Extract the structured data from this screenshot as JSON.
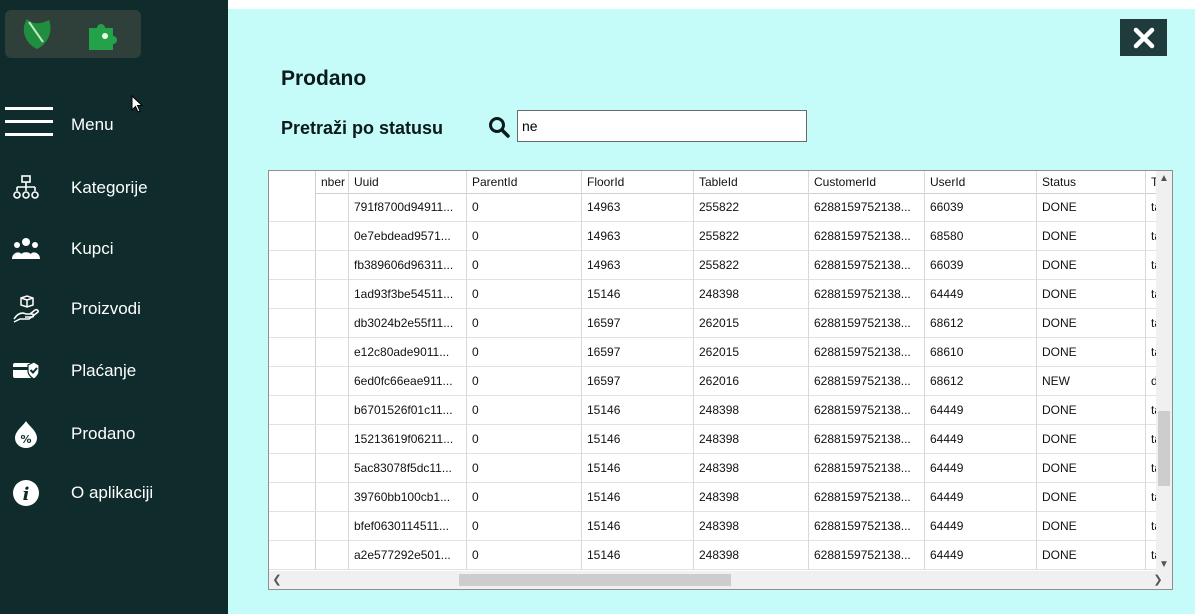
{
  "sidebar": {
    "menu_label": "Menu",
    "items": [
      {
        "label": "Kategorije",
        "icon": "hierarchy-icon"
      },
      {
        "label": "Kupci",
        "icon": "users-icon"
      },
      {
        "label": "Proizvodi",
        "icon": "product-hand-icon"
      },
      {
        "label": "Plaćanje",
        "icon": "payment-check-icon"
      },
      {
        "label": "Prodano",
        "icon": "sold-percent-icon"
      },
      {
        "label": "O aplikaciji",
        "icon": "info-icon"
      }
    ]
  },
  "main": {
    "title": "Prodano",
    "search_label": "Pretraži po statusu",
    "search_value": "ne"
  },
  "grid": {
    "columns": [
      "nber",
      "Uuid",
      "ParentId",
      "FloorId",
      "TableId",
      "CustomerId",
      "UserId",
      "Status",
      "Ty"
    ],
    "rows": [
      [
        "",
        "791f8700d94911...",
        "0",
        "14963",
        "255822",
        "6288159752138...",
        "66039",
        "DONE",
        "tak"
      ],
      [
        "",
        "0e7ebdead9571...",
        "0",
        "14963",
        "255822",
        "6288159752138...",
        "68580",
        "DONE",
        "tak"
      ],
      [
        "",
        "fb389606d96311...",
        "0",
        "14963",
        "255822",
        "6288159752138...",
        "66039",
        "DONE",
        "tak"
      ],
      [
        "",
        "1ad93f3be54511...",
        "0",
        "15146",
        "248398",
        "6288159752138...",
        "64449",
        "DONE",
        "tak"
      ],
      [
        "",
        "db3024b2e55f11...",
        "0",
        "16597",
        "262015",
        "6288159752138...",
        "68612",
        "DONE",
        "tak"
      ],
      [
        "",
        "e12c80ade9011...",
        "0",
        "16597",
        "262015",
        "6288159752138...",
        "68610",
        "DONE",
        "tak"
      ],
      [
        "",
        "6ed0fc66eae911...",
        "0",
        "16597",
        "262016",
        "6288159752138...",
        "68612",
        "NEW",
        "del"
      ],
      [
        "",
        "b6701526f01c11...",
        "0",
        "15146",
        "248398",
        "6288159752138...",
        "64449",
        "DONE",
        "tak"
      ],
      [
        "",
        "15213619f06211...",
        "0",
        "15146",
        "248398",
        "6288159752138...",
        "64449",
        "DONE",
        "tak"
      ],
      [
        "",
        "5ac83078f5dc11...",
        "0",
        "15146",
        "248398",
        "6288159752138...",
        "64449",
        "DONE",
        "tak"
      ],
      [
        "",
        "39760bb100cb1...",
        "0",
        "15146",
        "248398",
        "6288159752138...",
        "64449",
        "DONE",
        "tak"
      ],
      [
        "",
        "bfef0630114511...",
        "0",
        "15146",
        "248398",
        "6288159752138...",
        "64449",
        "DONE",
        "tak"
      ],
      [
        "",
        "a2e577292e501...",
        "0",
        "15146",
        "248398",
        "6288159752138...",
        "64449",
        "DONE",
        "tak"
      ]
    ]
  },
  "colors": {
    "sidebar_bg": "#0f2b2b",
    "content_bg": "#c5fbf8",
    "close_bg": "#1f3b3b"
  }
}
